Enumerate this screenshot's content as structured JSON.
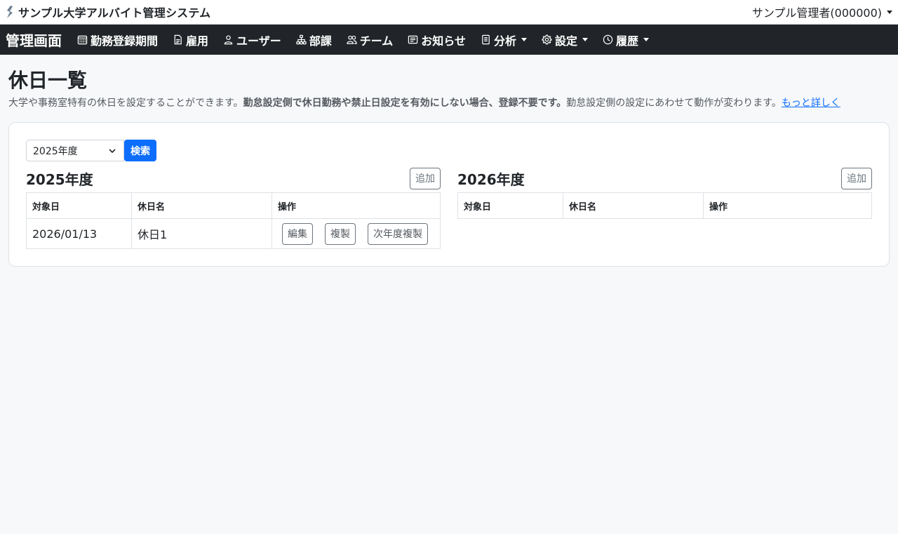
{
  "app": {
    "title": "サンプル大学アルバイト管理システム",
    "user_label": "サンプル管理者(000000)"
  },
  "nav": {
    "brand": "管理画面",
    "items": [
      {
        "label": "勤務登録期間",
        "icon": "calendar-icon"
      },
      {
        "label": "雇用",
        "icon": "document-icon"
      },
      {
        "label": "ユーザー",
        "icon": "person-icon"
      },
      {
        "label": "部課",
        "icon": "org-chart-icon"
      },
      {
        "label": "チーム",
        "icon": "people-icon"
      },
      {
        "label": "お知らせ",
        "icon": "news-icon"
      },
      {
        "label": "分析",
        "icon": "report-icon",
        "dropdown": true
      },
      {
        "label": "設定",
        "icon": "gear-icon",
        "dropdown": true
      },
      {
        "label": "履歴",
        "icon": "clock-icon",
        "dropdown": true
      }
    ]
  },
  "page": {
    "title": "休日一覧",
    "desc_plain1": "大学や事務室特有の休日を設定することができます。",
    "desc_bold": "勤怠設定側で休日勤務や禁止日設定を有効にしない場合、登録不要です。",
    "desc_plain2": "勤怠設定側の設定にあわせて動作が変わります。",
    "desc_link": "もっと詳しく"
  },
  "search": {
    "selected_year": "2025年度",
    "button": "検索"
  },
  "columns": {
    "date": "対象日",
    "name": "休日名",
    "ops": "操作"
  },
  "years": [
    {
      "title": "2025年度",
      "add_label": "追加",
      "rows": [
        {
          "date": "2026/01/13",
          "name": "休日1",
          "edit": "編集",
          "copy": "複製",
          "next_copy": "次年度複製"
        }
      ]
    },
    {
      "title": "2026年度",
      "add_label": "追加",
      "rows": []
    }
  ],
  "colors": {
    "navbar_bg": "#212529",
    "primary": "#0d6efd",
    "page_bg": "#f7f8fa"
  }
}
